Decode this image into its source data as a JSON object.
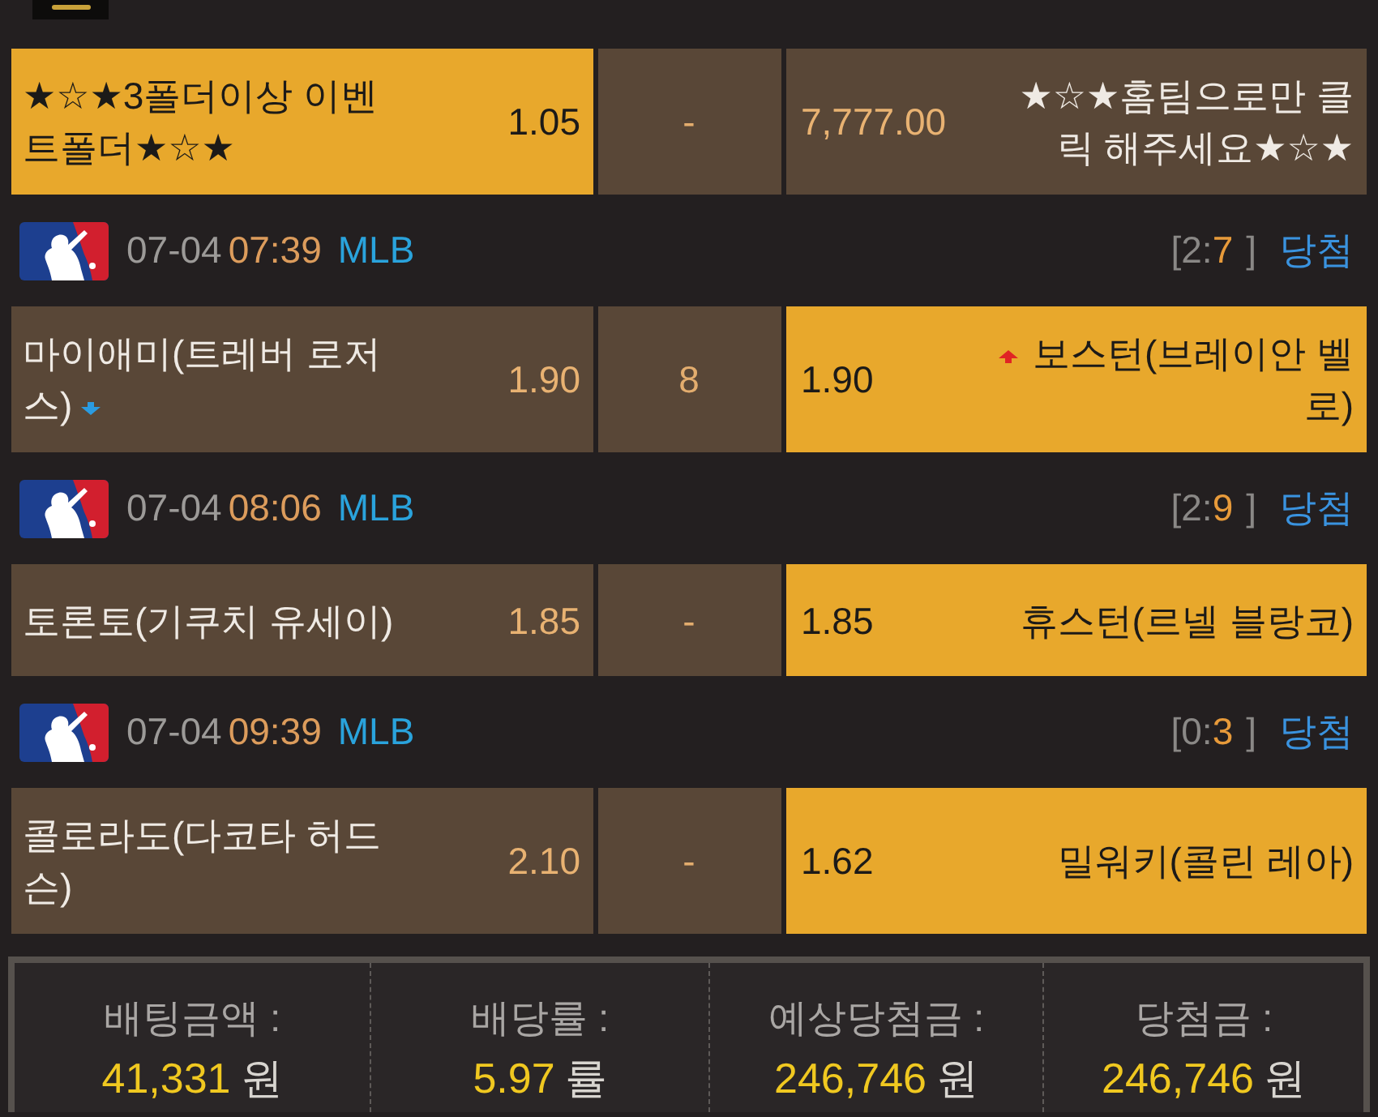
{
  "games": [
    {
      "bet": {
        "home": {
          "name": "★☆★3폴더이상 이벤트폴더★☆★",
          "odds": "1.05",
          "selected": true
        },
        "middle": {
          "value": "-",
          "selected": false
        },
        "away": {
          "name": "★☆★홈팀으로만 클릭 해주세요★☆★",
          "odds": "7,777.00",
          "selected": false
        }
      }
    },
    {
      "header": {
        "date": "07-04",
        "time": "07:39",
        "league": "MLB",
        "score": [
          {
            "text": "[2:",
            "kind": "plain"
          },
          {
            "text": "7",
            "kind": "accent"
          },
          {
            "text": "]",
            "kind": "plain"
          }
        ],
        "result": "당첨"
      },
      "bet": {
        "home": {
          "name": "마이애미(트레버 로저스)",
          "odds": "1.90",
          "selected": false,
          "odds_down": true
        },
        "middle": {
          "value": "8",
          "selected": false
        },
        "away": {
          "name": "보스턴(브레이안 벨로)",
          "odds": "1.90",
          "selected": true,
          "odds_up": true
        }
      }
    },
    {
      "header": {
        "date": "07-04",
        "time": "08:06",
        "league": "MLB",
        "score": [
          {
            "text": "[2:",
            "kind": "plain"
          },
          {
            "text": "9",
            "kind": "accent"
          },
          {
            "text": "]",
            "kind": "plain"
          }
        ],
        "result": "당첨"
      },
      "bet": {
        "home": {
          "name": "토론토(기쿠치 유세이)",
          "odds": "1.85",
          "selected": false
        },
        "middle": {
          "value": "-",
          "selected": false
        },
        "away": {
          "name": "휴스턴(르넬 블랑코)",
          "odds": "1.85",
          "selected": true
        }
      }
    },
    {
      "header": {
        "date": "07-04",
        "time": "09:39",
        "league": "MLB",
        "score": [
          {
            "text": "[0:",
            "kind": "plain"
          },
          {
            "text": "3",
            "kind": "accent"
          },
          {
            "text": "]",
            "kind": "plain"
          }
        ],
        "result": "당첨"
      },
      "bet": {
        "home": {
          "name": "콜로라도(다코타 허드슨)",
          "odds": "2.10",
          "selected": false
        },
        "middle": {
          "value": "-",
          "selected": false
        },
        "away": {
          "name": "밀워키(콜린 레아)",
          "odds": "1.62",
          "selected": true
        }
      }
    }
  ],
  "summary": [
    {
      "label": "배팅금액 :",
      "amount": "41,331",
      "unit": "원"
    },
    {
      "label": "배당률 :",
      "amount": "5.97",
      "unit": "률"
    },
    {
      "label": "예상당첨금 :",
      "amount": "246,746",
      "unit": "원"
    },
    {
      "label": "당첨금 :",
      "amount": "246,746",
      "unit": "원"
    }
  ]
}
